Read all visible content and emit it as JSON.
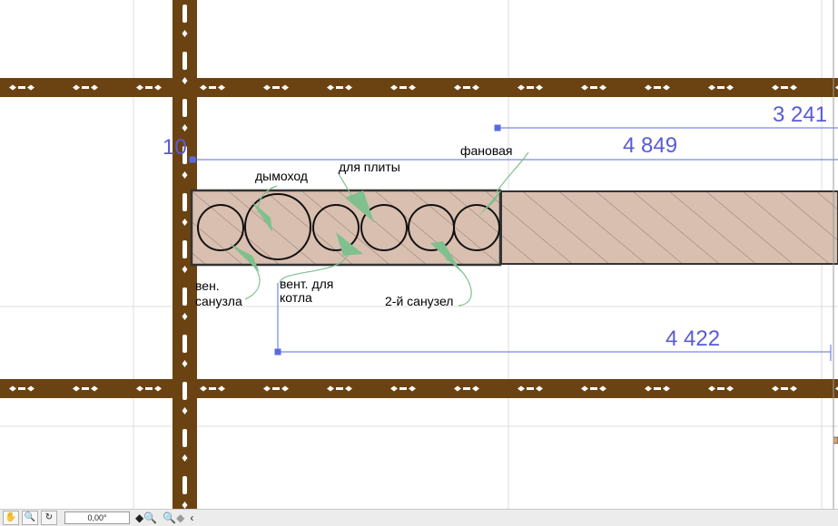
{
  "dimensions": {
    "top_right": "3 241",
    "offset": "10",
    "upper": "4 849",
    "lower": "4 422"
  },
  "labels": {
    "chimney": "дымоход",
    "for_stove": "для плиты",
    "fan_pipe": "фановая",
    "vent_bathroom_1": "вен.",
    "vent_bathroom_2": "санузла",
    "vent_boiler_1": "вент. для",
    "vent_boiler_2": "котла",
    "second_bathroom": "2-й санузел"
  },
  "statusbar": {
    "angle": "0,00°"
  },
  "colors": {
    "beam": "#6b4312",
    "hatch_fill": "#d9bfb0",
    "dimension": "#5a5ad6",
    "arrow": "#7fc08e"
  }
}
